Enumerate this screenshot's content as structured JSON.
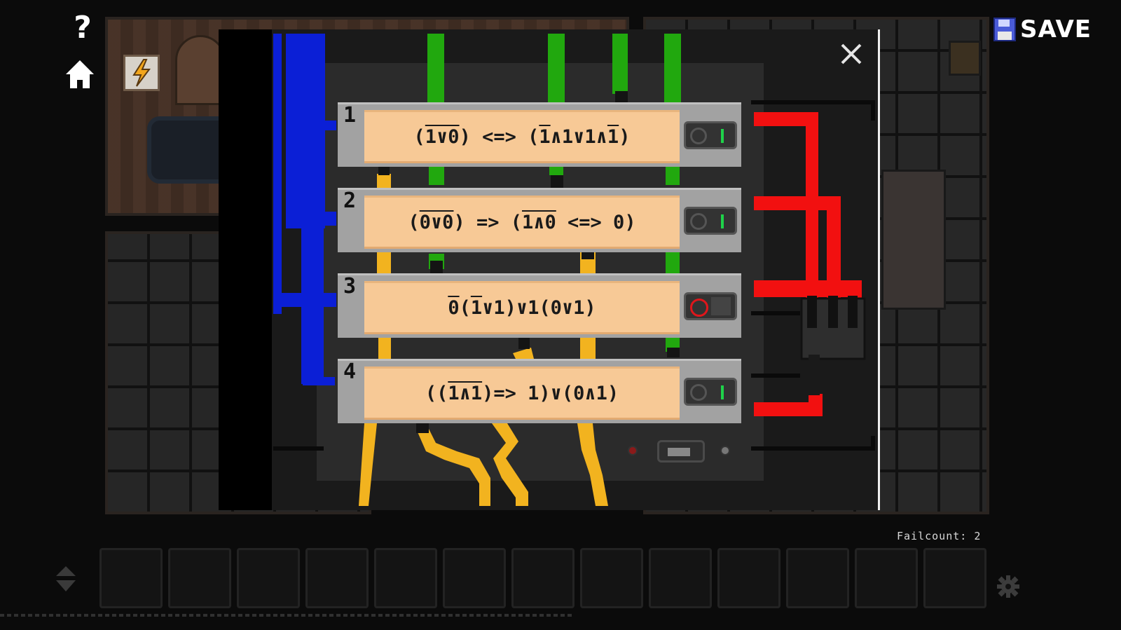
{
  "header": {
    "save_label": "SAVE",
    "help_glyph": "?"
  },
  "puzzle": {
    "close_glyph": "X",
    "rows": [
      {
        "number": "1",
        "formula_parts": [
          {
            "t": "(",
            "ov": false
          },
          {
            "t": "1∨0",
            "ov": true
          },
          {
            "t": ") <=> (",
            "ov": false
          },
          {
            "t": "1",
            "ov": true
          },
          {
            "t": "∧1∨1∧",
            "ov": false
          },
          {
            "t": "1",
            "ov": true
          },
          {
            "t": ")",
            "ov": false
          }
        ],
        "switch_state": "on"
      },
      {
        "number": "2",
        "formula_parts": [
          {
            "t": "(",
            "ov": false
          },
          {
            "t": "0∨0",
            "ov": true
          },
          {
            "t": ") => (",
            "ov": false
          },
          {
            "t": "1∧0",
            "ov": true
          },
          {
            "t": " <=> 0)",
            "ov": false
          }
        ],
        "switch_state": "on"
      },
      {
        "number": "3",
        "formula_parts": [
          {
            "t": "0",
            "ov": true
          },
          {
            "t": "(",
            "ov": false
          },
          {
            "t": "1",
            "ov": true
          },
          {
            "t": "∨1)∨1(0∨1)",
            "ov": false
          }
        ],
        "switch_state": "off"
      },
      {
        "number": "4",
        "formula_parts": [
          {
            "t": "((",
            "ov": false
          },
          {
            "t": "1∧1",
            "ov": true
          },
          {
            "t": ")=> 1)∨(0∧1)",
            "ov": false
          }
        ],
        "switch_state": "on"
      }
    ]
  },
  "status": {
    "failcount_text": "Failcount: 2"
  },
  "inventory": {
    "slot_count": 13
  },
  "colors": {
    "blue_wire": "#0b1fd6",
    "green_wire": "#21a80e",
    "yellow_wire": "#f2b31f",
    "red_wire": "#f21010",
    "on_indicator": "#1fd24a",
    "off_indicator": "#e0161b"
  }
}
